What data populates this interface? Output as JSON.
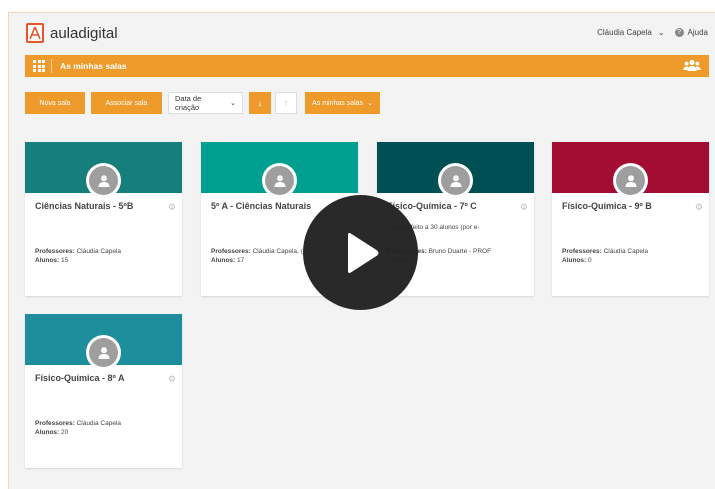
{
  "app": {
    "logo_text_a": "aula",
    "logo_text_b": "digital",
    "user_name": "Cláudia Capela",
    "help_label": "Ajuda"
  },
  "rooms_bar": {
    "title": "As minhas salas",
    "grid_icon": "grid-icon",
    "group_icon": "users-icon",
    "color": "#ee9b2c"
  },
  "toolbar": {
    "new_room": "Nova sala",
    "associate_room": "Associar sala",
    "sort_select": "Data de criação",
    "filter_select": "As minhas salas"
  },
  "labels": {
    "professors": "Professores:",
    "students": "Alunos:"
  },
  "cards": [
    {
      "name": "Ciências Naturais - 5ºB",
      "color": "#177f7b",
      "description": "",
      "professors": "Cláudia Capela",
      "students": "15"
    },
    {
      "name": "5º A - Ciências Naturais",
      "color": "#00a090",
      "description": "",
      "professors": "Cláudia Capela, (",
      "students": "17"
    },
    {
      "name": "Físico-Química - 7º C",
      "color": "#004f55",
      "description": "Convite feito a 30 alunos (por e-",
      "professors": "Bruno Duarte - PROF",
      "students": ""
    },
    {
      "name": "Físico-Química - 9º B",
      "color": "#a30d33",
      "description": "",
      "professors": "Cláudia Capela",
      "students": "0"
    },
    {
      "name": "Físico-Química - 8º A",
      "color": "#1f8e9c",
      "description": "",
      "professors": "Cláudia Capela",
      "students": "20"
    }
  ]
}
